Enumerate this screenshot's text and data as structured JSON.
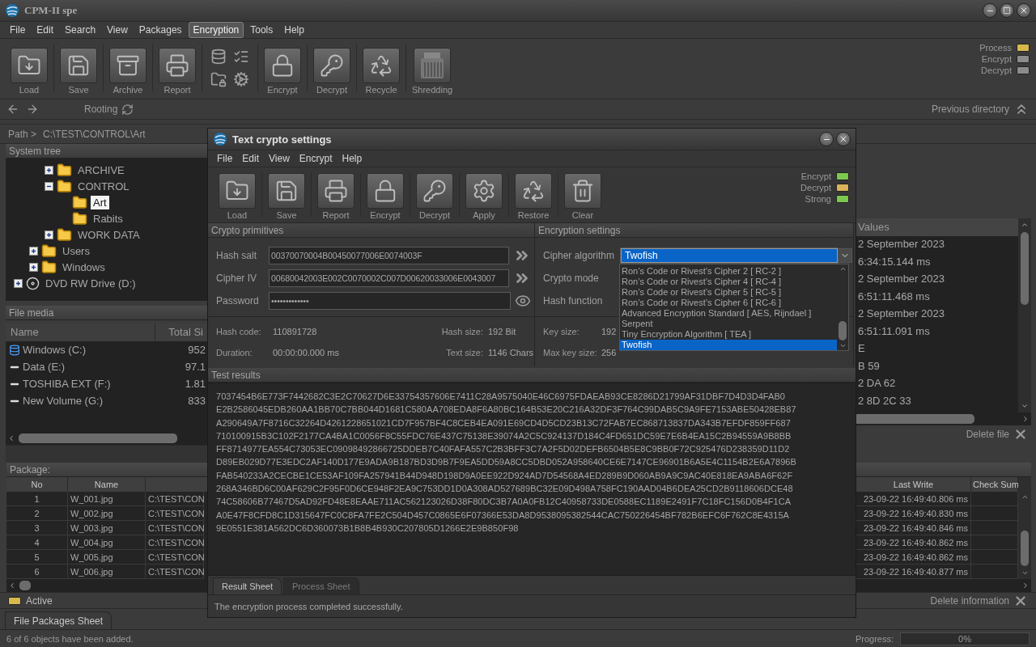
{
  "window": {
    "title": "CPM-II spe"
  },
  "menu": [
    {
      "label": "File",
      "selected": false
    },
    {
      "label": "Edit",
      "selected": false
    },
    {
      "label": "Search",
      "selected": false
    },
    {
      "label": "View",
      "selected": false
    },
    {
      "label": "Packages",
      "selected": false
    },
    {
      "label": "Encryption",
      "selected": true
    },
    {
      "label": "Tools",
      "selected": false
    },
    {
      "label": "Help",
      "selected": false
    }
  ],
  "toolbar": [
    {
      "label": "Load"
    },
    {
      "label": "Save"
    },
    {
      "label": "Archive"
    },
    {
      "label": "Report"
    },
    {
      "label": "Encrypt"
    },
    {
      "label": "Decrypt"
    },
    {
      "label": "Recycle"
    },
    {
      "label": "Shredding"
    }
  ],
  "indicators": [
    {
      "label": "Process",
      "color": "#d8b84c"
    },
    {
      "label": "Encrypt",
      "color": "#8c8c8c"
    },
    {
      "label": "Decrypt",
      "color": "#8c8c8c"
    }
  ],
  "nav": {
    "rooting": "Rooting",
    "previous": "Previous directory"
  },
  "path": {
    "label": "Path >",
    "value": "C:\\TEST\\CONTROL\\Art"
  },
  "system_tree": {
    "title": "System tree",
    "items": [
      {
        "children": [
          {
            "children": [
              {
                "label": "ARCHIVE",
                "kind": "folder",
                "expanded": false,
                "selected": false
              },
              {
                "label": "CONTROL",
                "kind": "folder",
                "expanded": true,
                "selected": false,
                "children": [
                  {
                    "label": "Art",
                    "kind": "folder",
                    "selected": true
                  },
                  {
                    "label": "Rabits",
                    "kind": "folder",
                    "selected": false
                  }
                ]
              },
              {
                "label": "WORK DATA",
                "kind": "folder",
                "expanded": false,
                "selected": false
              }
            ]
          },
          {
            "label": "Users",
            "kind": "folder",
            "expanded": false,
            "selected": false
          },
          {
            "label": "Windows",
            "kind": "folder",
            "expanded": false,
            "selected": false
          }
        ]
      },
      {
        "label": "DVD RW Drive (D:)",
        "kind": "drive",
        "expanded": false,
        "selected": false
      }
    ]
  },
  "file_media": {
    "title": "File media",
    "columns": [
      "Name",
      "Total Si"
    ],
    "rows": [
      {
        "name": "Windows  (C:)",
        "size": "952",
        "kind": "system"
      },
      {
        "name": "Data (E:)",
        "size": "97.1",
        "kind": "disk"
      },
      {
        "name": "TOSHIBA EXT (F:)",
        "size": "1.81",
        "kind": "disk"
      },
      {
        "name": "New Volume (G:)",
        "size": "833",
        "kind": "disk"
      }
    ]
  },
  "values_panel": {
    "header": "Values",
    "rows": [
      "2 September 2023",
      "6:34:15.144 ms",
      "2 September 2023",
      "6:51:11.468 ms",
      "2 September 2023",
      "6:51:11.091 ms",
      "E",
      "B 59",
      "2 DA 62",
      "2 8D 2C 33"
    ]
  },
  "delete_file": "Delete file",
  "package": {
    "title": "Package:",
    "columns": [
      "No",
      "Name",
      "Last Write",
      "Check Sum"
    ],
    "rows": [
      {
        "no": "1",
        "name": "W_001.jpg",
        "path": "C:\\TEST\\CON",
        "last_write": "23-09-22 16:49:40.806 ms"
      },
      {
        "no": "2",
        "name": "W_002.jpg",
        "path": "C:\\TEST\\CON",
        "last_write": "23-09-22 16:49:40.830 ms"
      },
      {
        "no": "3",
        "name": "W_003.jpg",
        "path": "C:\\TEST\\CON",
        "last_write": "23-09-22 16:49:40.846 ms"
      },
      {
        "no": "4",
        "name": "W_004.jpg",
        "path": "C:\\TEST\\CON",
        "last_write": "23-09-22 16:49:40.862 ms"
      },
      {
        "no": "5",
        "name": "W_005.jpg",
        "path": "C:\\TEST\\CON",
        "last_write": "23-09-22 16:49:40.862 ms"
      },
      {
        "no": "6",
        "name": "W_006.jpg",
        "path": "C:\\TEST\\CON",
        "last_write": "23-09-22 16:49:40.877 ms"
      }
    ]
  },
  "active": {
    "label": "Active",
    "color": "#d8b84c"
  },
  "delete_information": "Delete information",
  "sheet_tabs": [
    {
      "label": "File Packages Sheet",
      "selected": true
    }
  ],
  "status_bar": {
    "message": "6 of 6 objects have been added.",
    "progress_label": "Progress:",
    "progress_text": "0%",
    "level": 0
  },
  "dialog": {
    "title": "Text crypto settings",
    "menu": [
      "File",
      "Edit",
      "View",
      "Encrypt",
      "Help"
    ],
    "toolbar": [
      {
        "label": "Load"
      },
      {
        "label": "Save"
      },
      {
        "label": "Report"
      },
      {
        "label": "Encrypt"
      },
      {
        "label": "Decrypt"
      },
      {
        "label": "Apply"
      },
      {
        "label": "Restore"
      },
      {
        "label": "Clear"
      }
    ],
    "indicators": [
      {
        "label": "Encrypt",
        "color": "#7cc84e"
      },
      {
        "label": "Decrypt",
        "color": "#d9b45a"
      },
      {
        "label": "Strong",
        "color": "#7cc84e"
      }
    ],
    "primitives": {
      "title": "Crypto primitives",
      "fields": [
        {
          "label": "Hash salt",
          "value": "00370070004B00450077006E0074003F",
          "kind": "forward"
        },
        {
          "label": "Cipher IV",
          "value": "00680042003E002C0070002C007D00620033006E0043007",
          "kind": "forward"
        },
        {
          "label": "Password",
          "value": "•••••••••••••",
          "kind": "reveal"
        }
      ]
    },
    "info": [
      {
        "label": "Hash code:",
        "value": "110891728"
      },
      {
        "label": "Hash size:",
        "value": "192 Bit"
      },
      {
        "label": "Duration:",
        "value": "00:00:00.000 ms"
      },
      {
        "label": "Text size:",
        "value": "1146 Chars"
      }
    ],
    "settings": {
      "title": "Encryption settings",
      "cipher_algorithm": {
        "label": "Cipher algorithm",
        "value": "Twofish",
        "expanded": true,
        "options": [
          {
            "label": "Ron’s Code or Rivest’s Cipher 2 [ RC-2 ]",
            "selected": false
          },
          {
            "label": "Ron’s Code or Rivest’s Cipher 4 [ RC-4 ]",
            "selected": false
          },
          {
            "label": "Ron’s Code or Rivest’s Cipher 5 [ RC-5 ]",
            "selected": false
          },
          {
            "label": "Ron’s Code or Rivest’s Cipher 6 [ RC-6 ]",
            "selected": false
          },
          {
            "label": "Advanced Encryption Standard [ AES, Rijndael ]",
            "selected": false
          },
          {
            "label": "Serpent",
            "selected": false
          },
          {
            "label": "Tiny Encryption Algorithm [ TEA ]",
            "selected": false
          },
          {
            "label": "Twofish",
            "selected": true
          }
        ]
      },
      "crypto_mode": {
        "label": "Crypto mode"
      },
      "hash_function": {
        "label": "Hash function"
      },
      "key_info": [
        {
          "label": "Key size:",
          "value": "192"
        },
        {
          "label": "Max key size:",
          "value": "256"
        }
      ]
    },
    "results": {
      "title": "Test results",
      "lines": [
        "7037454B6E773F7442682C3E2C70627D6E33754357606E7411C28A9575040E46C6975FDAEAB93CE8286D21799AF31DBF7D4D3D4FAB0",
        "E2B2586045EDB260AA1BB70C7BB044D1681C580AA708EDA8F6A80BC164B53E20C216A32DF3F764C99DAB5C9A9FE7153ABE50428EB87",
        "A290649A7F8716C32264D4261228651021CD7F957BF4C8CEB4EA091E69CD4D5CD23B13C72FAB7EC868713837DA343B7EFDF859FF687",
        "710100915B3C102F2177CA4BA1C0056F8C55FDC76E437C75138E39074A2C5C924137D184C4FD651DC59E7E6B4EA15C2B94559A9B8BB",
        "FF8714977EA554C73053EC09098492866725DDEB7C40FAFA557C2B3BFF3C7A2F5D02DEFB6504B5E8C9BB0F72C925476D238359D11D2",
        "D89EB029D77E3EDC2AF140D177E9ADA9B187BD3D9B7F9EA5DD59A8CC5DBD052A958640CE6E7147CE96901B6A5E4C1154B2E6A7896B",
        "FAB540233A2CECBE1CE53AF109FA257941B44D948D198D9A0EE922D924AD7D54568A4ED289B9D060AB9A9C9AC40E818EA9ABA6F62F",
        "268A346BD6C00AF629C2F95F0D6CE948F2EA9C753DD1D0A308AD527689BC32E09D498A758FC190AAD04B6DEA25CD2B9118606DCE48",
        "74C58606B77467D5AD92FD48E8EAAE711AC562123026D38F80DC3B7A0A0FB12C40958733DE0588EC1189E2491F7C18FC156D0B4F1CA",
        "A0E47F8CFD8C1D315647FC0C8FA7FE2C504D457C0865E6F07366E53DA8D9538095382544CAC750226454BF782B6EFC6F762C8E4315A",
        "9E0551E381A562DC6D360073B1B8B4B930C207805D1266E2E9B850F98"
      ]
    },
    "tabs": [
      {
        "label": "Result Sheet",
        "selected": true
      },
      {
        "label": "Process Sheet",
        "selected": false
      }
    ],
    "status": "The encryption process completed successfully."
  }
}
